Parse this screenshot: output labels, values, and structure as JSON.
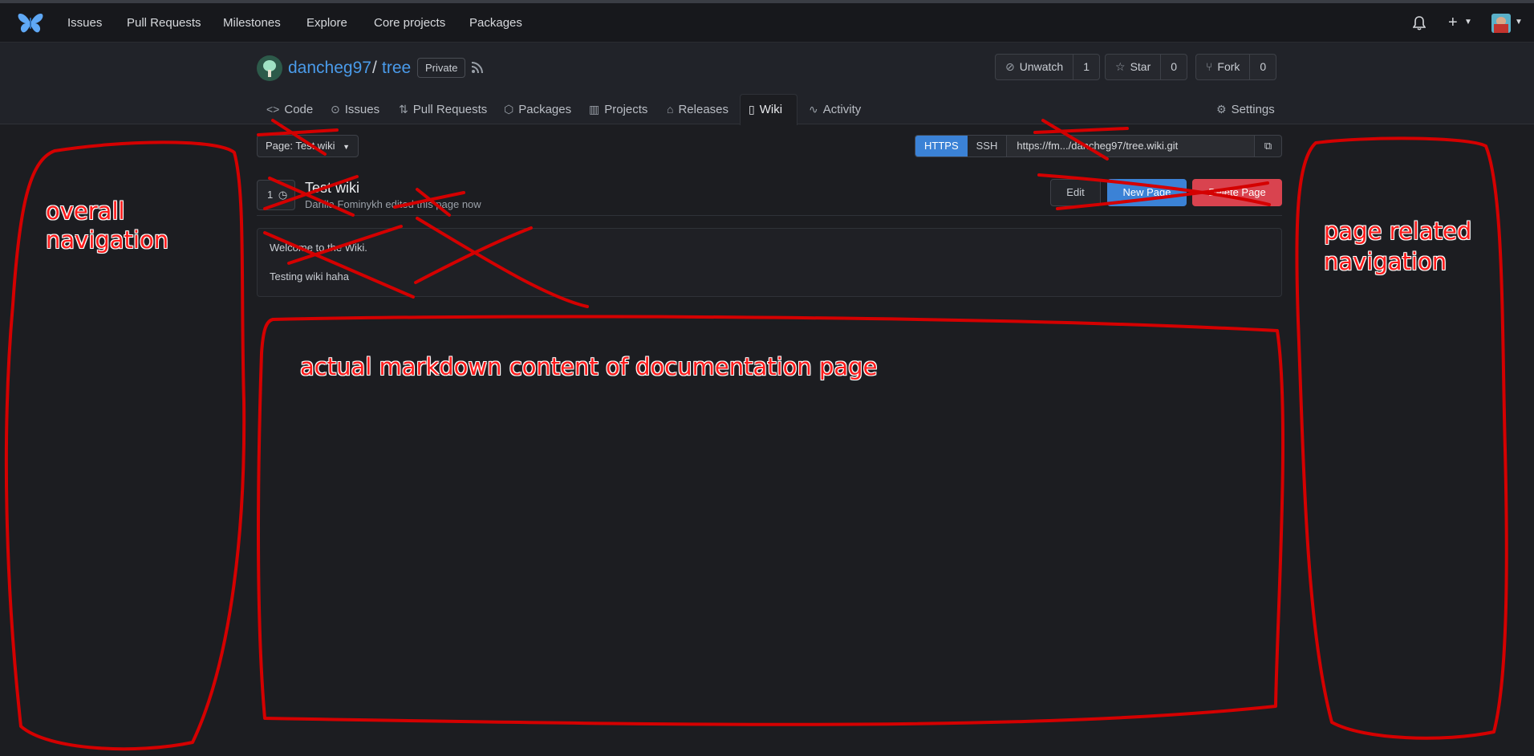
{
  "topnav": {
    "items": [
      "Issues",
      "Pull Requests",
      "Milestones",
      "Explore",
      "Core projects",
      "Packages"
    ],
    "plus_label": "+"
  },
  "repo": {
    "owner": "dancheg97",
    "slash": "/",
    "name": "tree",
    "visibility": "Private",
    "unwatch_label": "Unwatch",
    "unwatch_count": "1",
    "star_label": "Star",
    "star_count": "0",
    "fork_label": "Fork",
    "fork_count": "0"
  },
  "tabs": [
    {
      "label": "Code",
      "icon": "code-icon"
    },
    {
      "label": "Issues",
      "icon": "issue-icon"
    },
    {
      "label": "Pull Requests",
      "icon": "pull-request-icon"
    },
    {
      "label": "Packages",
      "icon": "package-icon"
    },
    {
      "label": "Projects",
      "icon": "project-icon"
    },
    {
      "label": "Releases",
      "icon": "tag-icon"
    },
    {
      "label": "Wiki",
      "icon": "book-icon"
    },
    {
      "label": "Activity",
      "icon": "pulse-icon"
    }
  ],
  "settings_label": "Settings",
  "toolbar": {
    "page_dropdown": "Page: Test wiki",
    "https_label": "HTTPS",
    "ssh_label": "SSH",
    "clone_url": "https://fm.../dancheg97/tree.wiki.git"
  },
  "page": {
    "history_count": "1",
    "title": "Test wiki",
    "subtitle": "Danila Fominykh edited this page now",
    "edit_label": "Edit",
    "new_label": "New Page",
    "delete_label": "Delete Page",
    "content": [
      "Welcome to the Wiki.",
      "Testing wiki haha"
    ]
  },
  "annotations": {
    "overall_nav": [
      "overall",
      "navigation"
    ],
    "page_nav": [
      "page related",
      "navigation"
    ],
    "markdown": "actual markdown content of documentation page"
  },
  "colors": {
    "accent": "#3b82d6",
    "danger": "#d9434f",
    "link": "#4a9bea",
    "annotation": "#ff1a1a"
  }
}
